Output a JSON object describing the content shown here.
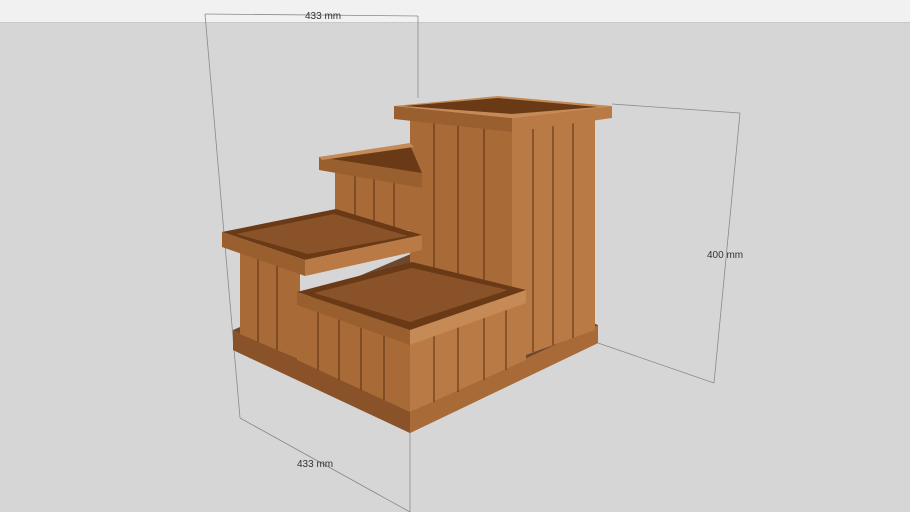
{
  "toolbar": {},
  "dimensions": {
    "top": "433 mm",
    "bottom": "433 mm",
    "right": "400 mm"
  },
  "model": {
    "colors": {
      "wood_light": "#b97a45",
      "wood_mid": "#9a5f2f",
      "wood_dark": "#6a3a16",
      "interior": "#8a5228",
      "plank_line": "#5a2e10"
    }
  }
}
